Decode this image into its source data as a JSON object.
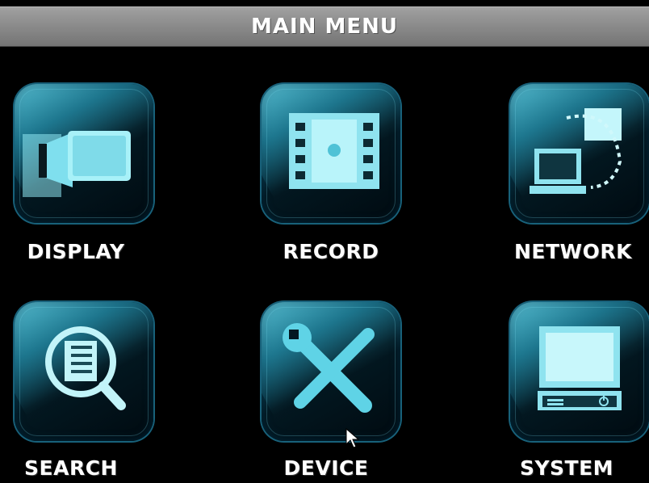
{
  "header": {
    "title": "MAIN MENU"
  },
  "menu": {
    "items": [
      {
        "label": "DISPLAY",
        "icon": "display-icon"
      },
      {
        "label": "RECORD",
        "icon": "film-strip-icon"
      },
      {
        "label": "NETWORK",
        "icon": "network-icon"
      },
      {
        "label": "SEARCH",
        "icon": "magnifier-document-icon"
      },
      {
        "label": "DEVICE",
        "icon": "wrench-screwdriver-icon"
      },
      {
        "label": "SYSTEM",
        "icon": "computer-power-icon"
      }
    ]
  },
  "theme": {
    "background": "#000000",
    "title_bar": "#8c8c8c",
    "icon_accent": "#7fe0f0",
    "label_color": "#ffffff"
  }
}
